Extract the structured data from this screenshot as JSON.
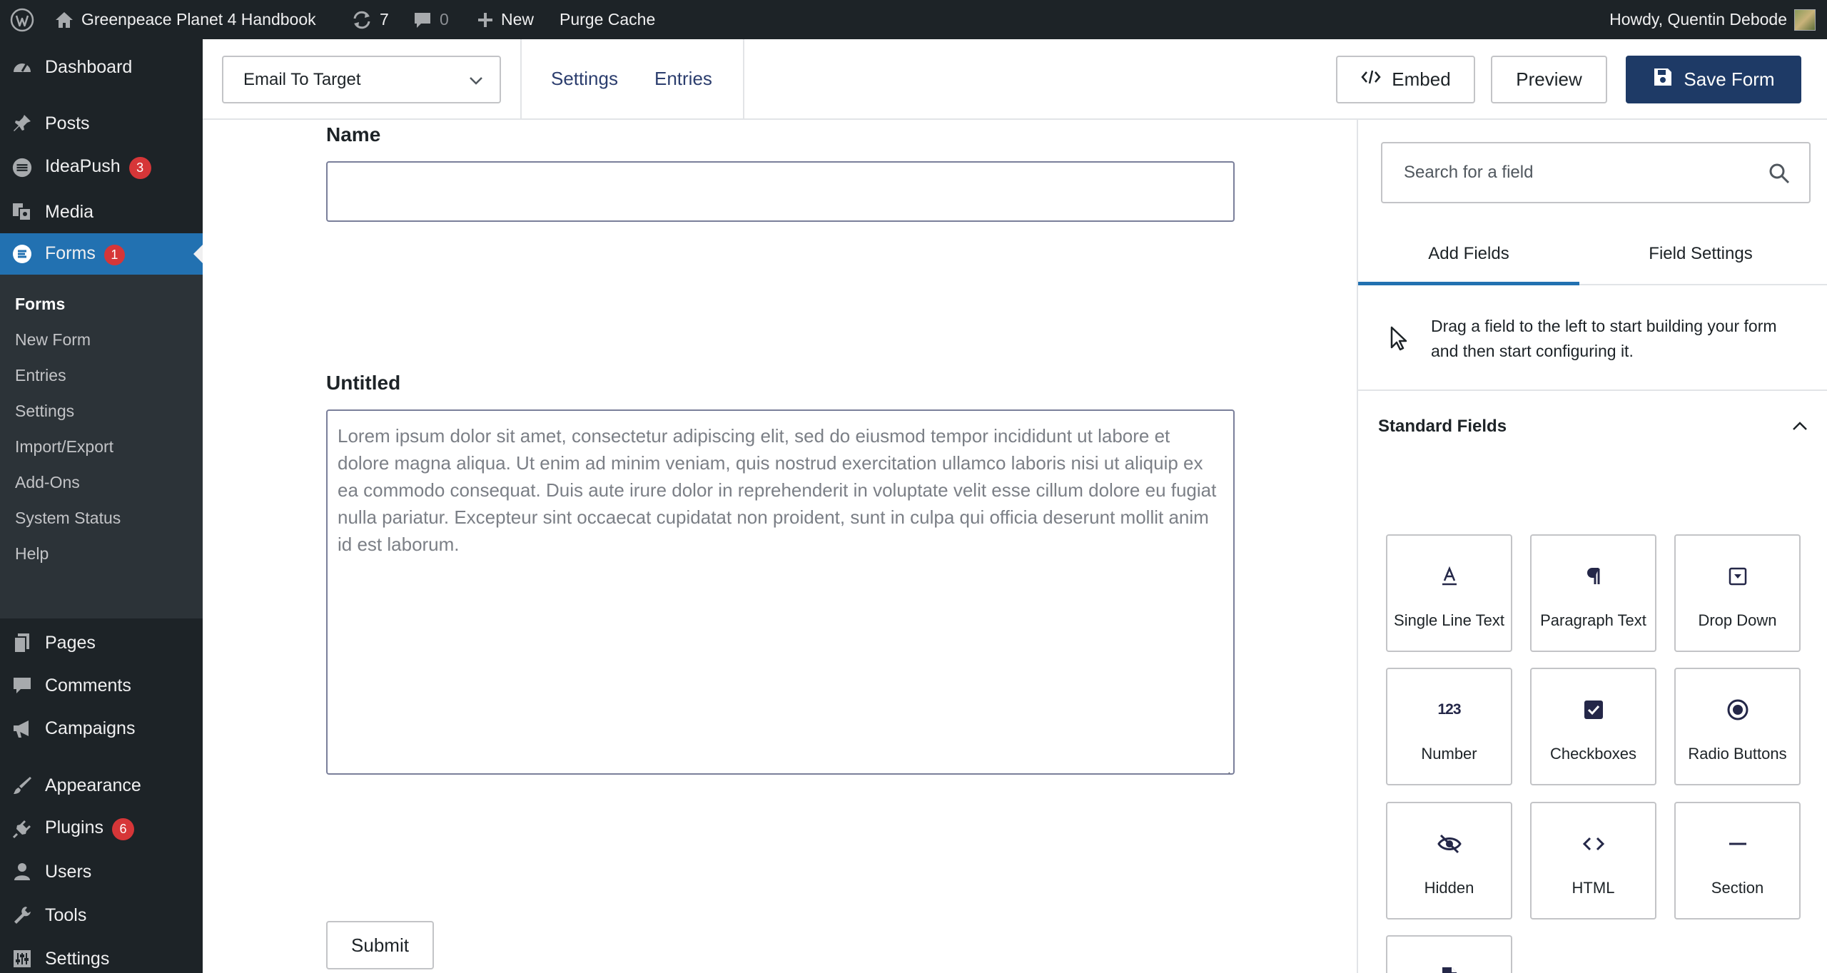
{
  "admin_bar": {
    "site_name": "Greenpeace Planet 4 Handbook",
    "updates_count": "7",
    "comments_count": "0",
    "new_label": "New",
    "purge_label": "Purge Cache",
    "greeting": "Howdy, Quentin Debode"
  },
  "sidebar": {
    "items": [
      {
        "label": "Dashboard",
        "icon": "dashboard-icon"
      },
      {
        "label": "Posts",
        "icon": "pin-icon"
      },
      {
        "label": "IdeaPush",
        "icon": "ideapush-icon",
        "badge": "3"
      },
      {
        "label": "Media",
        "icon": "media-icon"
      },
      {
        "label": "Forms",
        "icon": "forms-icon",
        "badge": "1"
      },
      {
        "label": "Pages",
        "icon": "pages-icon"
      },
      {
        "label": "Comments",
        "icon": "comment-icon"
      },
      {
        "label": "Campaigns",
        "icon": "megaphone-icon"
      },
      {
        "label": "Appearance",
        "icon": "brush-icon"
      },
      {
        "label": "Plugins",
        "icon": "plugin-icon",
        "badge": "6"
      },
      {
        "label": "Users",
        "icon": "user-icon"
      },
      {
        "label": "Tools",
        "icon": "wrench-icon"
      },
      {
        "label": "Settings",
        "icon": "settings-icon"
      }
    ],
    "submenu": [
      "Forms",
      "New Form",
      "Entries",
      "Settings",
      "Import/Export",
      "Add-Ons",
      "System Status",
      "Help"
    ]
  },
  "toolbar": {
    "form_name": "Email To Target",
    "settings_link": "Settings",
    "entries_link": "Entries",
    "embed_label": "Embed",
    "preview_label": "Preview",
    "save_label": "Save Form"
  },
  "form": {
    "name_label": "Name",
    "untitled_label": "Untitled",
    "textarea_value": "Lorem ipsum dolor sit amet, consectetur adipiscing elit, sed do eiusmod tempor incididunt ut labore et dolore magna aliqua. Ut enim ad minim veniam, quis nostrud exercitation ullamco laboris nisi ut aliquip ex ea commodo consequat. Duis aute irure dolor in reprehenderit in voluptate velit esse cillum dolore eu fugiat nulla pariatur. Excepteur sint occaecat cupidatat non proident, sunt in culpa qui officia deserunt mollit anim id est laborum.",
    "submit_label": "Submit"
  },
  "panel": {
    "search_placeholder": "Search for a field",
    "tabs": [
      "Add Fields",
      "Field Settings"
    ],
    "hint": "Drag a field to the left to start building your form and then start configuring it.",
    "section_title": "Standard Fields",
    "fields": [
      {
        "label": "Single Line Text",
        "icon": "text-line-icon"
      },
      {
        "label": "Paragraph Text",
        "icon": "pilcrow-icon"
      },
      {
        "label": "Drop Down",
        "icon": "dropdown-icon"
      },
      {
        "label": "Number",
        "icon": "number-icon"
      },
      {
        "label": "Checkboxes",
        "icon": "checkbox-icon"
      },
      {
        "label": "Radio Buttons",
        "icon": "radio-icon"
      },
      {
        "label": "Hidden",
        "icon": "eye-slash-icon"
      },
      {
        "label": "HTML",
        "icon": "code-icon"
      },
      {
        "label": "Section",
        "icon": "minus-icon"
      },
      {
        "label": "",
        "icon": "document-icon"
      }
    ],
    "number_icon_text": "123"
  },
  "colors": {
    "admin_bg": "#1d2327",
    "accent": "#2271b1",
    "primary_button": "#1e3a66",
    "badge": "#d63638"
  }
}
